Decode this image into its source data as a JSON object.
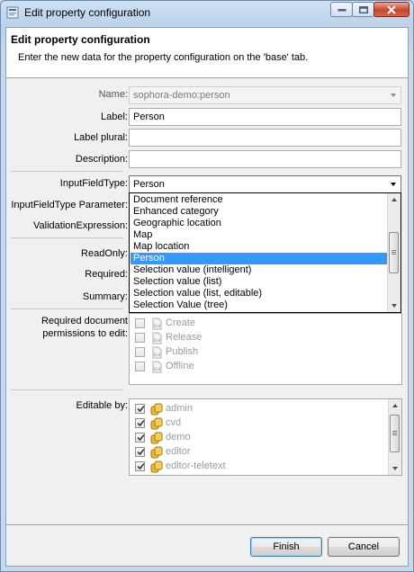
{
  "window": {
    "title": "Edit property configuration"
  },
  "header": {
    "title": "Edit property configuration",
    "description": "Enter the new data for the property configuration on the 'base' tab."
  },
  "form": {
    "name": {
      "label": "Name:",
      "value": "sophora-demo:person"
    },
    "label": {
      "label": "Label:",
      "value": "Person"
    },
    "label_plural": {
      "label": "Label plural:",
      "value": ""
    },
    "description": {
      "label": "Description:",
      "value": ""
    },
    "input_field_type": {
      "label": "InputFieldType:",
      "value": "Person",
      "options_visible": [
        "Document reference",
        "Enhanced category",
        "Geographic location",
        "Map",
        "Map location",
        "Person",
        "Selection value (intelligent)",
        "Selection value (list)",
        "Selection value (list, editable)",
        "Selection Value (tree)"
      ],
      "selected_index": 5
    },
    "input_field_type_parameter": {
      "label": "InputFieldType Parameter:"
    },
    "validation_expression": {
      "label": "ValidationExpression:"
    },
    "read_only": {
      "label": "ReadOnly:"
    },
    "required": {
      "label": "Required:"
    },
    "summary": {
      "label": "Summary:"
    },
    "permissions": {
      "label_line1": "Required document",
      "label_line2": "permissions to edit:",
      "items": [
        {
          "label": "Create",
          "checked": false
        },
        {
          "label": "Release",
          "checked": false
        },
        {
          "label": "Publish",
          "checked": false
        },
        {
          "label": "Offline",
          "checked": false
        }
      ]
    },
    "editable_by": {
      "label": "Editable by:",
      "items": [
        {
          "label": "admin",
          "checked": true
        },
        {
          "label": "cvd",
          "checked": true
        },
        {
          "label": "demo",
          "checked": true
        },
        {
          "label": "editor",
          "checked": true
        },
        {
          "label": "editor-teletext",
          "checked": true
        }
      ]
    }
  },
  "buttons": {
    "finish": "Finish",
    "cancel": "Cancel"
  },
  "colors": {
    "selection": "#3399ff",
    "focus_border": "#3c7fb1"
  }
}
